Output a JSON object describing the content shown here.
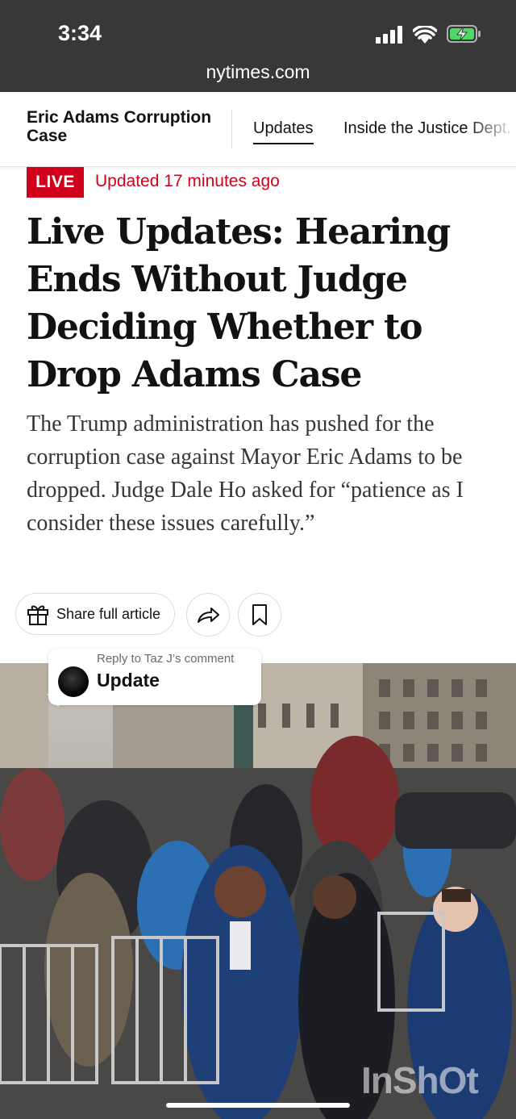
{
  "status_bar": {
    "time": "3:34",
    "icons": [
      "cellular-signal-icon",
      "wifi-icon",
      "battery-charging-icon"
    ],
    "battery_color": "#4cd964"
  },
  "browser": {
    "url": "nytimes.com"
  },
  "section_nav": {
    "title": "Eric Adams Corruption Case",
    "tabs": [
      {
        "label": "Updates",
        "active": true
      },
      {
        "label": "Inside the Justice Dept."
      }
    ]
  },
  "article": {
    "live_badge": "LIVE",
    "updated": "Updated 17 minutes ago",
    "headline": "Live Updates: Hearing Ends Without Judge Deciding Whether to Drop Adams Case",
    "summary": "The Trump administration has pushed for the corruption case against Mayor Eric Adams to be dropped. Judge Dale Ho asked for “patience as I consider these issues carefully.”",
    "share_label": "Share full article",
    "accent_color": "#d0021b"
  },
  "reply_bubble": {
    "label": "Reply to Taz J’s comment",
    "text": "Update"
  },
  "watermark": "InShOt"
}
